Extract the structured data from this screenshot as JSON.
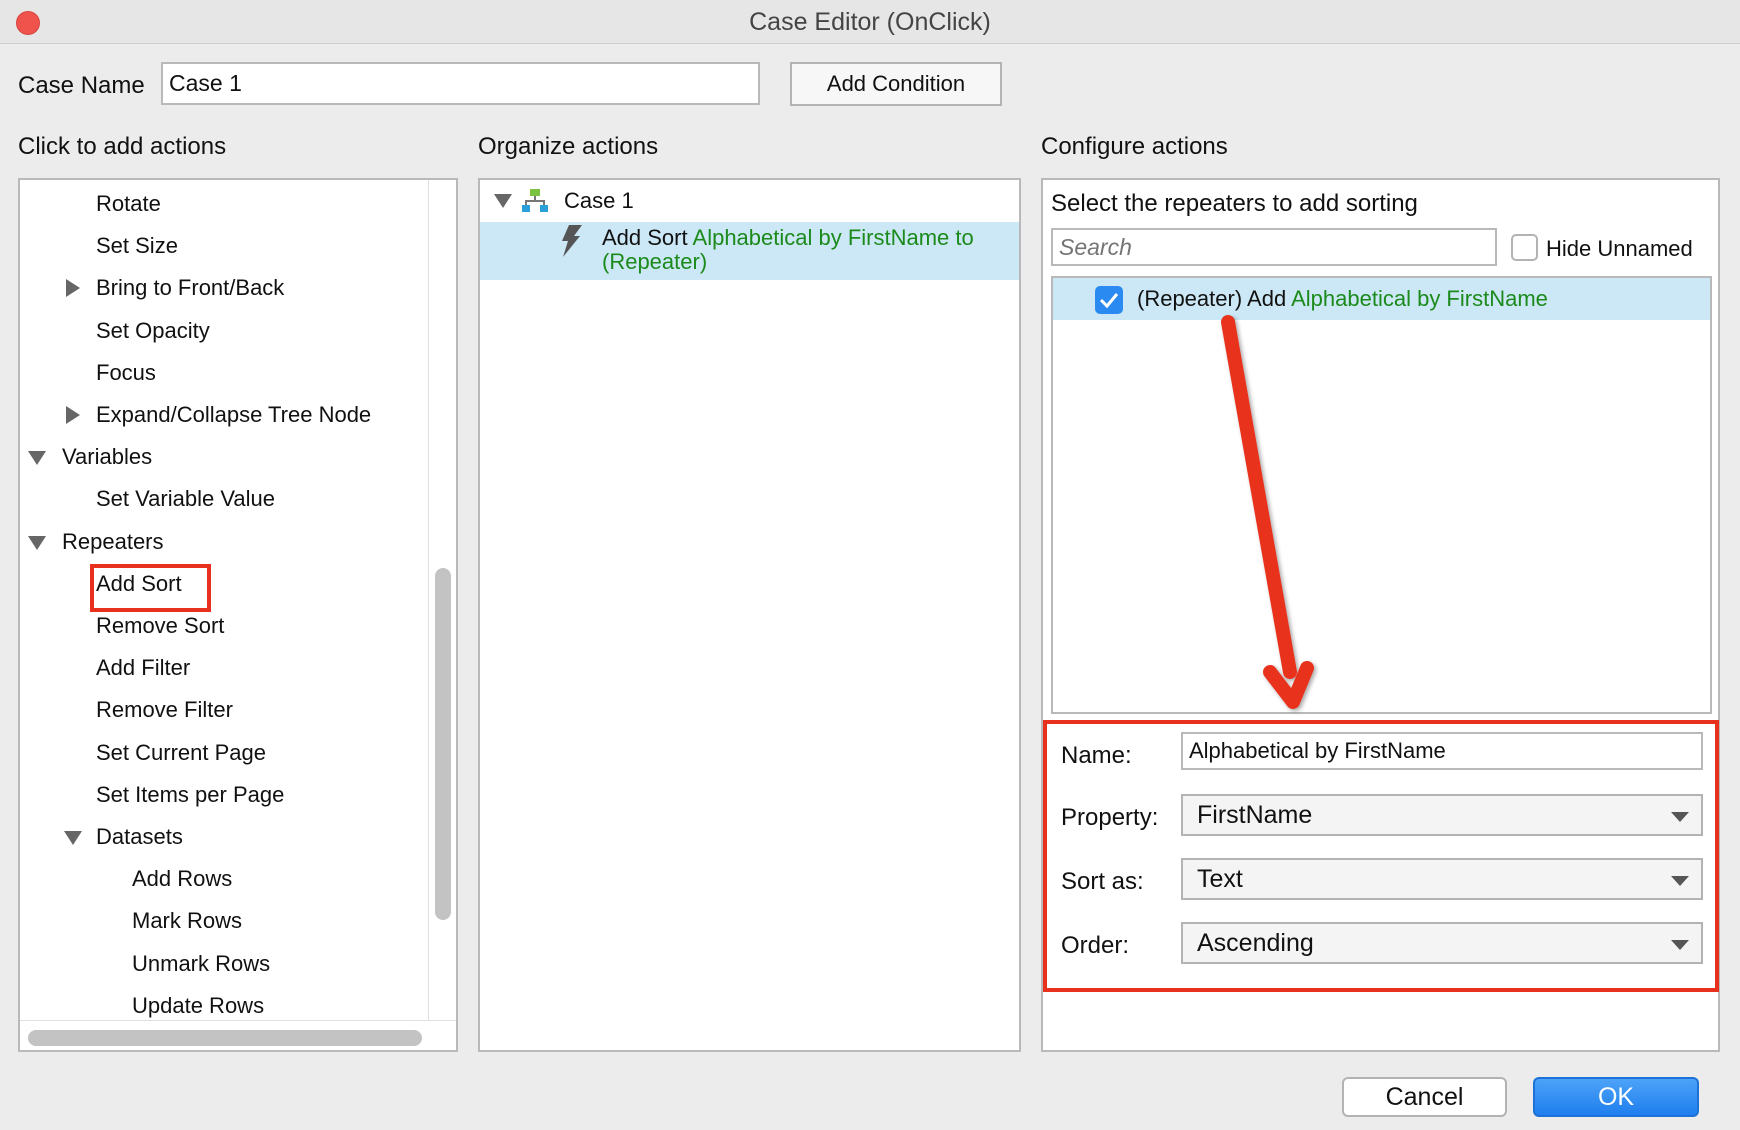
{
  "window": {
    "title": "Case Editor (OnClick)"
  },
  "case_name": {
    "label": "Case Name",
    "value": "Case 1"
  },
  "add_condition_label": "Add Condition",
  "left_panel": {
    "header": "Click to add actions",
    "items": [
      {
        "label": "Rotate",
        "expander": "none",
        "level": 2
      },
      {
        "label": "Set Size",
        "expander": "none",
        "level": 2
      },
      {
        "label": "Bring to Front/Back",
        "expander": "collapsed",
        "level": 2
      },
      {
        "label": "Set Opacity",
        "expander": "none",
        "level": 2
      },
      {
        "label": "Focus",
        "expander": "none",
        "level": 2
      },
      {
        "label": "Expand/Collapse Tree Node",
        "expander": "collapsed",
        "level": 2
      },
      {
        "label": "Variables",
        "expander": "expanded",
        "level": 1
      },
      {
        "label": "Set Variable Value",
        "expander": "none",
        "level": 2
      },
      {
        "label": "Repeaters",
        "expander": "expanded",
        "level": 1
      },
      {
        "label": "Add Sort",
        "expander": "none",
        "level": 2,
        "highlighted": true
      },
      {
        "label": "Remove Sort",
        "expander": "none",
        "level": 2
      },
      {
        "label": "Add Filter",
        "expander": "none",
        "level": 2
      },
      {
        "label": "Remove Filter",
        "expander": "none",
        "level": 2
      },
      {
        "label": "Set Current Page",
        "expander": "none",
        "level": 2
      },
      {
        "label": "Set Items per Page",
        "expander": "none",
        "level": 2
      },
      {
        "label": "Datasets",
        "expander": "expanded",
        "level": 2
      },
      {
        "label": "Add Rows",
        "expander": "none",
        "level": 3
      },
      {
        "label": "Mark Rows",
        "expander": "none",
        "level": 3
      },
      {
        "label": "Unmark Rows",
        "expander": "none",
        "level": 3
      },
      {
        "label": "Update Rows",
        "expander": "none",
        "level": 3
      }
    ]
  },
  "middle_panel": {
    "header": "Organize actions",
    "case_label": "Case 1",
    "action": {
      "verb": "Add Sort",
      "detail": "Alphabetical by FirstName to",
      "target": "(Repeater)"
    }
  },
  "right_panel": {
    "header": "Configure actions",
    "subheader": "Select the repeaters to add sorting",
    "search_placeholder": "Search",
    "hide_unnamed_label": "Hide Unnamed",
    "repeater_item": {
      "prefix": "(Repeater) Add",
      "name": "Alphabetical by FirstName",
      "checked": true
    },
    "form": {
      "name_label": "Name:",
      "name_value": "Alphabetical by FirstName",
      "property_label": "Property:",
      "property_value": "FirstName",
      "sort_as_label": "Sort as:",
      "sort_as_value": "Text",
      "order_label": "Order:",
      "order_value": "Ascending"
    }
  },
  "footer": {
    "cancel_label": "Cancel",
    "ok_label": "OK"
  },
  "colors": {
    "accent": "#2a8af2",
    "annotation": "#e8301f",
    "selection": "#cce8f6",
    "green_text": "#1b8a1b"
  }
}
